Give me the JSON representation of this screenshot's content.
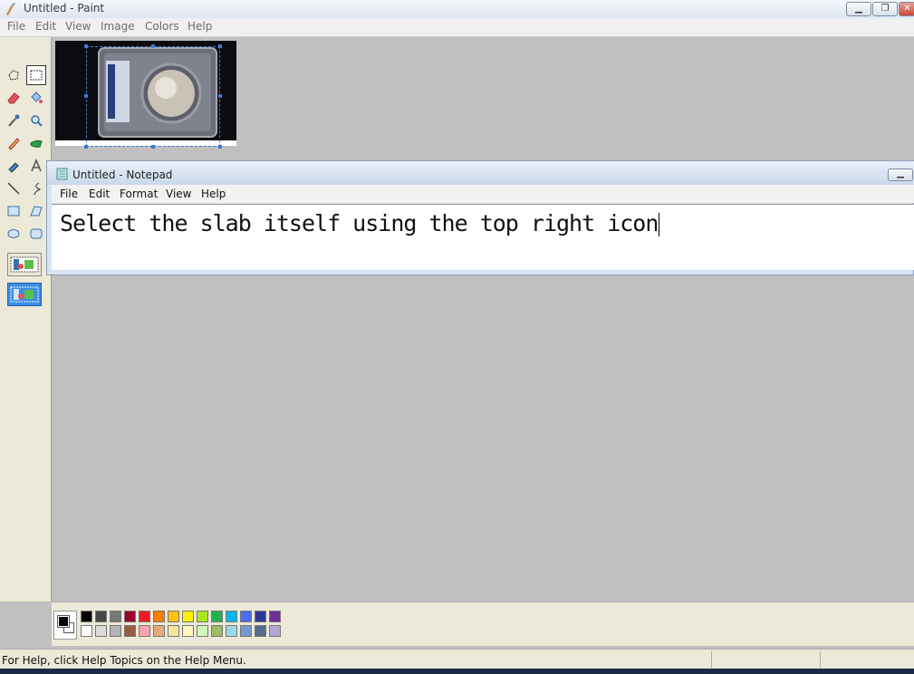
{
  "paint": {
    "title": "Untitled - Paint",
    "menu": [
      "File",
      "Edit",
      "View",
      "Image",
      "Colors",
      "Help"
    ]
  },
  "notepad": {
    "title": "Untitled - Notepad",
    "menu": [
      "File",
      "Edit",
      "Format",
      "View",
      "Help"
    ],
    "text": "Select the slab itself using the top right icon"
  },
  "palette": {
    "top_row": [
      "#000000",
      "#464646",
      "#787878",
      "#980030",
      "#ed1c24",
      "#ff7e00",
      "#ffc20e",
      "#fff200",
      "#a8e61d",
      "#22b14c",
      "#00b7ef",
      "#4d6df3",
      "#2f3699",
      "#6f3198"
    ],
    "bottom_row": [
      "#ffffff",
      "#dcdcdc",
      "#b4b4b4",
      "#9c5a3c",
      "#ffa3b1",
      "#e5aa7a",
      "#f5e49c",
      "#fff9bd",
      "#d3f9bc",
      "#9dbb61",
      "#99d9ea",
      "#709ad1",
      "#546d8e",
      "#b5a5d5"
    ],
    "foreground": "#000000",
    "background": "#ffffff"
  },
  "status": {
    "help_text": "For Help, click Help Topics on the Help Menu."
  },
  "icons": [
    "free-form-select-icon",
    "rect-select-icon",
    "eraser-icon",
    "fill-icon",
    "color-picker-icon",
    "magnifier-icon",
    "pencil-icon",
    "brush-icon",
    "airbrush-icon",
    "text-icon",
    "line-icon",
    "curve-icon",
    "rectangle-icon",
    "polygon-icon",
    "ellipse-icon",
    "rounded-rect-icon"
  ]
}
